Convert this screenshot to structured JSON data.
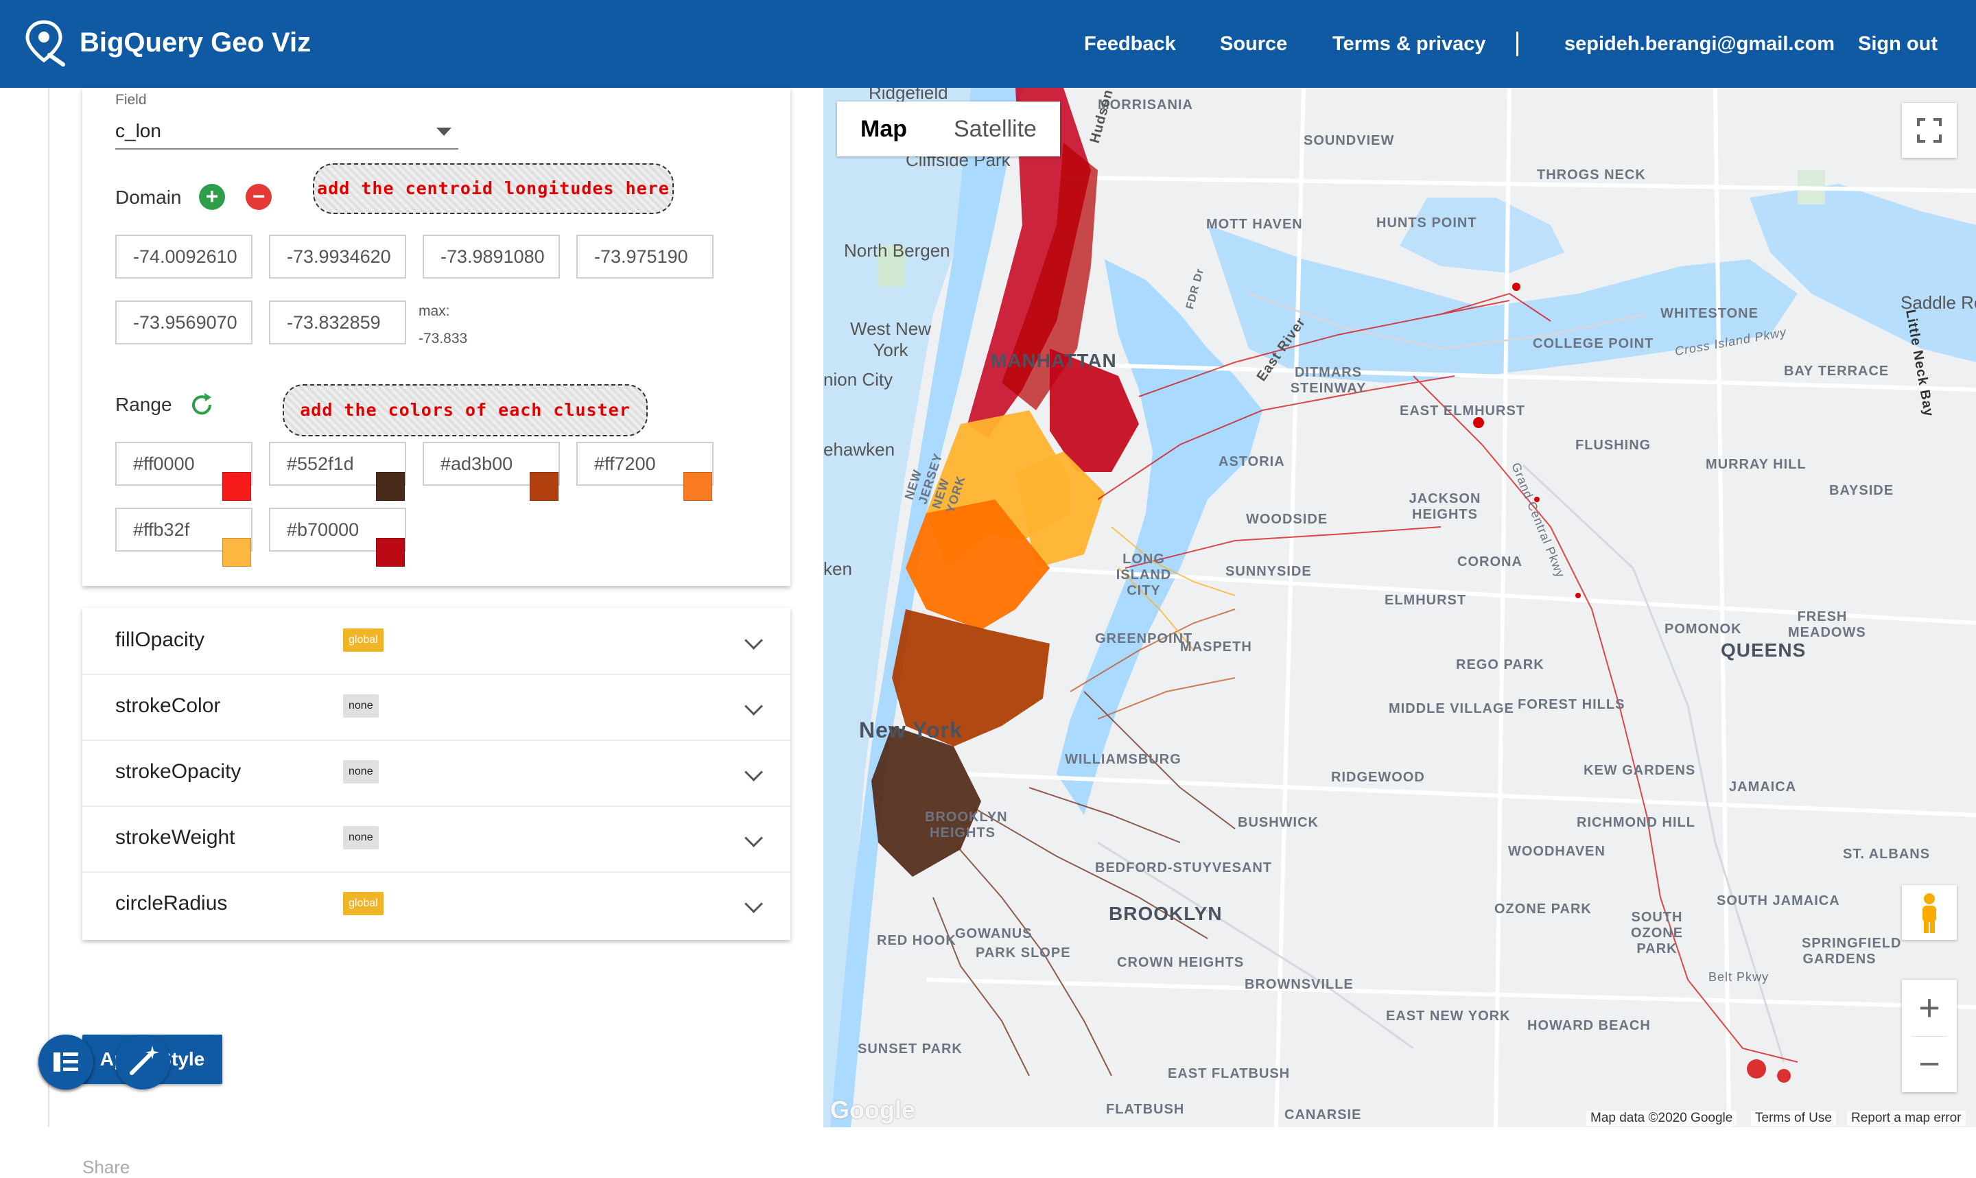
{
  "header": {
    "app_title": "BigQuery Geo Viz",
    "nav": [
      "Feedback",
      "Source",
      "Terms & privacy"
    ],
    "user_email": "sepideh.berangi@gmail.com",
    "sign_out": "Sign out"
  },
  "style_card": {
    "field_caption": "Field",
    "field_value": "c_lon",
    "domain_label": "Domain",
    "domain_callout": "add the centroid longitudes here",
    "domain_values": [
      "-74.0092610",
      "-73.9934620",
      "-73.9891080",
      "-73.975190",
      "-73.9569070",
      "-73.832859"
    ],
    "max_caption": "max:",
    "max_value": "-73.833",
    "range_label": "Range",
    "range_callout": "add the colors of each cluster here",
    "range_values": [
      "#ff0000",
      "#552f1d",
      "#ad3b00",
      "#ff7200",
      "#ffb32f",
      "#b70000"
    ],
    "swatch_colors": [
      "#f71a1a",
      "#4a2a1a",
      "#b2400f",
      "#fb7b22",
      "#fdb640",
      "#bb0a14"
    ]
  },
  "properties": [
    {
      "name": "fillOpacity",
      "badge": "global"
    },
    {
      "name": "strokeColor",
      "badge": "none"
    },
    {
      "name": "strokeOpacity",
      "badge": "none"
    },
    {
      "name": "strokeWeight",
      "badge": "none"
    },
    {
      "name": "circleRadius",
      "badge": "global"
    }
  ],
  "apply_button": "Apply Style",
  "share_ghost": "Share",
  "map": {
    "tabs": [
      "Map",
      "Satellite"
    ],
    "active_tab": "Map",
    "labels": {
      "ridgefield": "Ridgefield",
      "morrisania": "MORRISANIA",
      "soundview": "SOUNDVIEW",
      "throgs_neck": "THROGS NECK",
      "cliffside": "Cliffside Park",
      "north_bergen": "North Bergen",
      "mott_haven": "MOTT HAVEN",
      "hunts_point": "HUNTS POINT",
      "west_new_york": "West New York",
      "manhattan": "MANHATTAN",
      "whitestone": "WHITESTONE",
      "college_point": "COLLEGE POINT",
      "saddle_rock": "Saddle Ro",
      "union_city": "nion City",
      "bay_terrace": "BAY TERRACE",
      "ditmars": "DITMARS STEINWAY",
      "east_elmhurst": "EAST ELMHURST",
      "flushing": "FLUSHING",
      "weehawken": "ehawken",
      "astoria": "ASTORIA",
      "jackson_heights": "JACKSON HEIGHTS",
      "murray_hill": "MURRAY HILL",
      "bayside": "BAYSIDE",
      "woodside": "WOODSIDE",
      "corona": "CORONA",
      "long_island_city": "LONG ISLAND CITY",
      "sunnyside": "SUNNYSIDE",
      "elmhurst": "ELMHURST",
      "pomonok": "POMONOK",
      "fresh_meadows": "FRESH MEADOWS",
      "hoboken": "ken",
      "greenpoint": "GREENPOINT",
      "maspeth": "MASPETH",
      "rego_park": "REGO PARK",
      "queens": "QUEENS",
      "middle_village": "MIDDLE VILLAGE",
      "forest_hills": "FOREST HILLS",
      "new_york": "New York",
      "williamsburg": "WILLIAMSBURG",
      "ridgewood": "RIDGEWOOD",
      "kew_gardens": "KEW GARDENS",
      "jamaica": "JAMAICA",
      "brooklyn_heights": "BROOKLYN HEIGHTS",
      "bushwick": "BUSHWICK",
      "richmond_hill": "RICHMOND HILL",
      "woodhaven": "WOODHAVEN",
      "st_albans": "ST. ALBANS",
      "bed_stuy": "BEDFORD-STUYVESANT",
      "brooklyn": "BROOKLYN",
      "ozone_park": "OZONE PARK",
      "south_ozone_park": "SOUTH OZONE PARK",
      "south_jamaica": "SOUTH JAMAICA",
      "red_hook": "RED HOOK",
      "park_slope": "PARK SLOPE",
      "gowanus": "GOWANUS",
      "crown_heights": "CROWN HEIGHTS",
      "springfield_gardens": "SPRINGFIELD GARDENS",
      "brownsville": "BROWNSVILLE",
      "east_new_york": "EAST NEW YORK",
      "howard_beach": "HOWARD BEACH",
      "sunset_park": "SUNSET PARK",
      "east_flatbush": "EAST FLATBUSH",
      "flatbush": "FLATBUSH",
      "canarsie": "CANARSIE",
      "east_river": "East River",
      "hudson": "Hudson",
      "fdr": "FDR Dr",
      "grand_central": "Grand Central Pkwy",
      "cross_island": "Cross Island Pkwy",
      "little_neck_bay": "Little Neck Bay",
      "belt_pkwy": "Belt Pkwy",
      "nj_ny": "NEW JERSEY NEW YORK"
    },
    "attribution": {
      "map_data": "Map data ©2020 Google",
      "terms": "Terms of Use",
      "report": "Report a map error",
      "google": "Google"
    }
  }
}
